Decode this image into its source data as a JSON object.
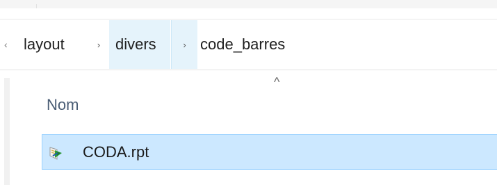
{
  "breadcrumb": {
    "items": [
      {
        "label": "layout"
      },
      {
        "label": "divers"
      },
      {
        "label": "code_barres"
      }
    ],
    "separator_glyph": "›",
    "overflow_glyph": "‹"
  },
  "file_list": {
    "columns": [
      {
        "label": "Nom",
        "sort": "ascending",
        "sort_glyph": "^"
      }
    ],
    "rows": [
      {
        "name": "CODA.rpt",
        "icon": "report-file-icon",
        "selected": true
      }
    ]
  },
  "colors": {
    "selection_fill": "#cce8ff",
    "selection_border": "#99d1ff",
    "hover_fill": "#e5f3fb",
    "header_text": "#4a5d75"
  }
}
